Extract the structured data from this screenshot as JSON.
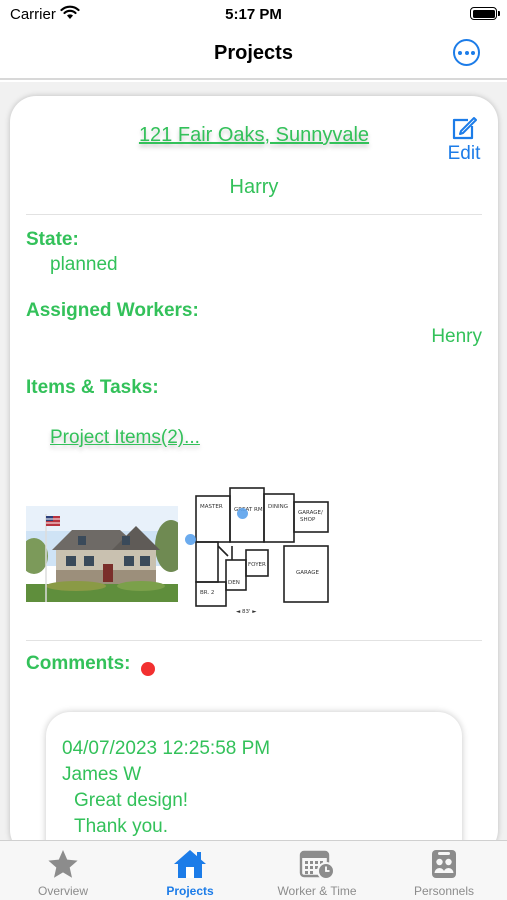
{
  "status_bar": {
    "carrier": "Carrier",
    "time": "5:17 PM"
  },
  "nav": {
    "title": "Projects",
    "more_icon": "ellipsis-circle-icon"
  },
  "project": {
    "address": "121 Fair Oaks, Sunnyvale",
    "edit_label": "Edit",
    "owner": "Harry",
    "state_label": "State:",
    "state_value": "planned",
    "workers_label": "Assigned Workers:",
    "workers_value": "Henry",
    "items_label": "Items & Tasks:",
    "items_link": "Project Items(2)...",
    "comments_label": "Comments:"
  },
  "comment": {
    "timestamp": "04/07/2023 12:25:58 PM",
    "author": "James W",
    "line1": "Great design!",
    "line2": "Thank you."
  },
  "tabs": [
    {
      "label": "Overview",
      "icon": "star-icon",
      "active": false
    },
    {
      "label": "Projects",
      "icon": "house-icon",
      "active": true
    },
    {
      "label": "Worker & Time",
      "icon": "calendar-clock-icon",
      "active": false
    },
    {
      "label": "Personnels",
      "icon": "people-icon",
      "active": false
    }
  ],
  "colors": {
    "accent_green": "#33c15a",
    "accent_blue": "#1c7ce8",
    "badge_red": "#f23030"
  }
}
